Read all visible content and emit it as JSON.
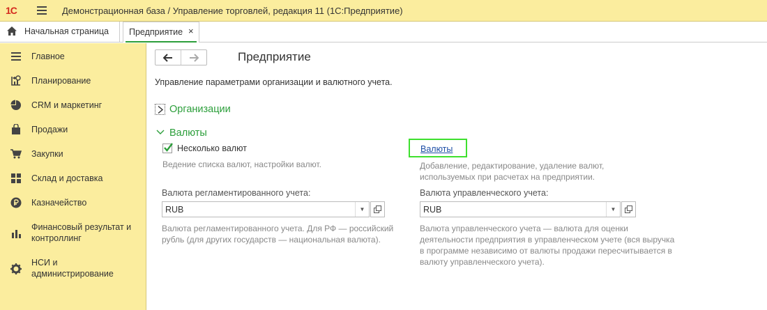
{
  "app": {
    "logo": "1С",
    "title": "Демонстрационная база / Управление торговлей, редакция 11  (1С:Предприятие)"
  },
  "tabs": {
    "home": "Начальная страница",
    "active": "Предприятие",
    "close": "×"
  },
  "sidebar": {
    "items": [
      {
        "label": "Главное",
        "icon": "list-icon"
      },
      {
        "label": "Планирование",
        "icon": "planning-icon"
      },
      {
        "label": "CRM и маркетинг",
        "icon": "pie-chart-icon"
      },
      {
        "label": "Продажи",
        "icon": "shopping-bag-icon"
      },
      {
        "label": "Закупки",
        "icon": "cart-icon"
      },
      {
        "label": "Склад и доставка",
        "icon": "warehouse-icon"
      },
      {
        "label": "Казначейство",
        "icon": "ruble-coin-icon"
      },
      {
        "label": "Финансовый результат и контроллинг",
        "icon": "bar-chart-icon"
      },
      {
        "label": "НСИ и администрирование",
        "icon": "gear-icon"
      }
    ]
  },
  "page": {
    "title": "Предприятие",
    "description": "Управление параметрами организации и валютного учета.",
    "nav_back": "🡐",
    "nav_forward": "🡒"
  },
  "organizations": {
    "title": "Организации"
  },
  "currencies": {
    "title": "Валюты",
    "multi_currency_label": "Несколько валют",
    "multi_currency_checked": true,
    "multi_currency_hint": "Ведение списка валют, настройки валют.",
    "link": "Валюты",
    "link_hint_1": "Добавление, редактирование, удаление валют,",
    "link_hint_2": "используемых при расчетах на предприятии.",
    "reg_label": "Валюта регламентированного учета:",
    "reg_value": "RUB",
    "reg_hint_1": "Валюта регламентированного учета. Для РФ — российский",
    "reg_hint_2": "рубль (для других государств — национальная валюта).",
    "mgmt_label": "Валюта управленческого учета:",
    "mgmt_value": "RUB",
    "mgmt_hint_1": "Валюта управленческого учета — валюта для оценки",
    "mgmt_hint_2": "деятельности предприятия в управленческом учете (вся выручка",
    "mgmt_hint_3": "в программе независимо от валюты продажи пересчитывается в",
    "mgmt_hint_4": "валюту управленческого учета)."
  },
  "colors": {
    "panel_yellow": "#FBED9E",
    "accent_green": "#2b9e3a",
    "link_blue": "#1d4fa5",
    "highlight_green": "#3ee02e"
  }
}
